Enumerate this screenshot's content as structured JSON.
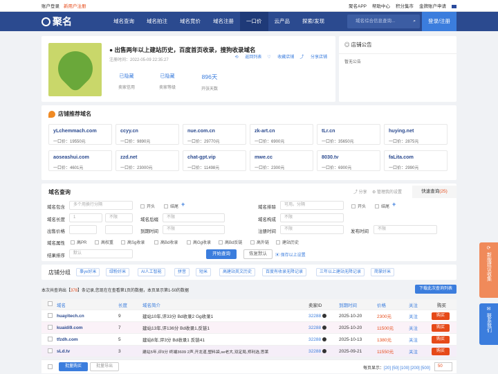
{
  "topbar": {
    "login": "账户登录",
    "register": "新用户注册",
    "app": "聚名APP",
    "help": "帮助中心",
    "points": "积分集市",
    "gold": "金牌账户申请"
  },
  "nav": {
    "logo": "聚名",
    "items": [
      "域名查询",
      "域名拍注",
      "域名竞价",
      "域名注册",
      "一口价",
      "云产品",
      "探索/发现"
    ],
    "search_placeholder": "域名综合信息查询...",
    "search_icon": "search-icon",
    "login": "登录/注册"
  },
  "shop": {
    "title": "出售两年以上建站历史，百度首页收录，搜狗收录域名",
    "time": "注册时间：2022-05-09 22:35:27",
    "back": "返回列表",
    "fav": "收藏店铺",
    "share": "分享店铺",
    "stats": [
      {
        "value": "已隐藏",
        "key": "卖家信用"
      },
      {
        "value": "已隐藏",
        "key": "卖家等级"
      },
      {
        "value": "896天",
        "key": "开张天数"
      }
    ]
  },
  "notice": {
    "title": "店铺公告",
    "body": "暂无公告"
  },
  "recommend": {
    "title": "店铺推荐域名",
    "items": [
      {
        "name": "yLchemmach.com",
        "price": "一口价：19550元"
      },
      {
        "name": "ccyy.cn",
        "price": "一口价：9890元"
      },
      {
        "name": "nue.com.cn",
        "price": "一口价：29770元"
      },
      {
        "name": "zk-art.cn",
        "price": "一口价：6900元"
      },
      {
        "name": "tLr.cn",
        "price": "一口价：35650元"
      },
      {
        "name": "huying.net",
        "price": "一口价：2875元"
      },
      {
        "name": "aoseashui.com",
        "price": "一口价：4601元"
      },
      {
        "name": "zzd.net",
        "price": "一口价：23000元"
      },
      {
        "name": "chat-gpt.vip",
        "price": "一口价：11498元"
      },
      {
        "name": "mwe.cc",
        "price": "一口价：2300元"
      },
      {
        "name": "8030.tv",
        "price": "一口价：6900元"
      },
      {
        "name": "faLita.com",
        "price": "一口价：2990元"
      }
    ]
  },
  "query": {
    "title": "域名查询",
    "share": "分享",
    "manage": "管理我的设置",
    "quick": "快速查询",
    "quick_count": "(25)",
    "contains_label": "域名包含",
    "contains_ph": "多个用换行分隔",
    "start": "开头",
    "end": "结尾",
    "exclude_label": "域名排除",
    "exclude_ph": "可用。分隔",
    "start2": "开头",
    "end2": "结尾",
    "length_label": "域名长度",
    "len_from": "1",
    "len_to": "不限",
    "suffix_label": "域名后缀",
    "suffix_val": "不限",
    "struct_label": "域名构成",
    "struct_val": "不限",
    "price_label": "出售价格",
    "expire_label": "到期时间",
    "expire_val": "不限",
    "reg_label": "注册时间",
    "reg_val": "不限",
    "pub_label": "发布时间",
    "pub_val": "不限",
    "attr_label": "域名属性",
    "attrs": [
      "高PR",
      "高权重",
      "高Sg收录",
      "高Bd收录",
      "高Gg收录",
      "高Bd反链",
      "高外链",
      "建站历史"
    ],
    "sort_label": "结果排序",
    "sort_val": "默认",
    "search_btn": "开始查询",
    "reset_btn": "恢复默认",
    "save": "保存以上设置"
  },
  "groups": {
    "title": "店铺分组",
    "tags": [
      "事ye好米",
      "绿粉好米",
      "AI人工智能",
      "拼音",
      "短米",
      "高建站英文历史",
      "百度有收录无降记录",
      "三年以上建站无降记录",
      "简掌好米"
    ]
  },
  "summary": {
    "pre": "本次共查询出【",
    "count": "378",
    "post": "】条记录,您现在在查看第1页的数据，本页显示第1-50的数据",
    "download": "下载此次查询列表"
  },
  "table": {
    "headers": [
      "域名",
      "长度",
      "域名简介",
      "卖家ID",
      "到期时间",
      "价格",
      "关注",
      "购买"
    ],
    "rows": [
      {
        "domain": "huayitech.cn",
        "len": "9",
        "desc": "建站10年,评33分  Bd收录2  Gg收录1",
        "seller": "32288",
        "expire": "2025-10-20",
        "price": "2300元",
        "follow": "关注",
        "buy": "购买"
      },
      {
        "domain": "kuaidi9.com",
        "len": "7",
        "desc": "建站13年,评136分  Bd收录1,反链1",
        "seller": "32288",
        "expire": "2025-10-20",
        "price": "11500元",
        "follow": "关注",
        "buy": "购买"
      },
      {
        "domain": "tfzdh.com",
        "len": "5",
        "desc": "建站6年,评3分  Bd收录1  反链41",
        "seller": "32288",
        "expire": "2025-10-13",
        "price": "1380元",
        "follow": "关注",
        "buy": "购买"
      },
      {
        "domain": "sLd.tv",
        "len": "3",
        "desc": "建站5年,评9分  终端3609  2声,开龙道,塑料袋,se老大,双定局,郑利选,思莱",
        "seller": "32288",
        "expire": "2025-09-21",
        "price": "11550元",
        "follow": "关注",
        "buy": "购买"
      }
    ]
  },
  "footer": {
    "batch_buy": "批量购买",
    "batch_export": "批量导出",
    "page_size_label": "每页显示：",
    "sizes": "[20] [50] [100] [200] [500]",
    "page_input": "50"
  },
  "side": {
    "feedback": "新版建议收集",
    "contact": "联系我们"
  }
}
